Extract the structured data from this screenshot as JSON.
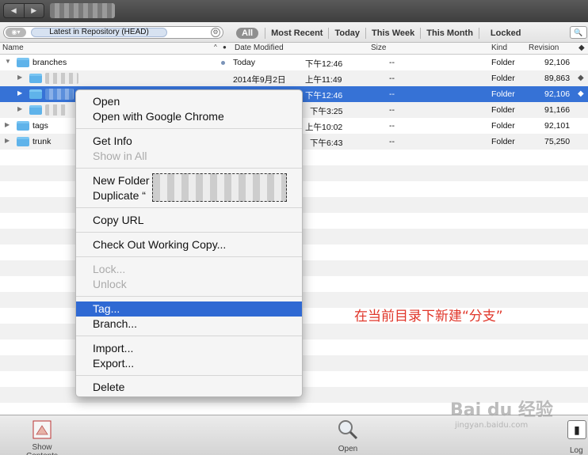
{
  "revision_field": {
    "toggle_icon": "toggle-icon",
    "value": "Latest in Repository (HEAD)",
    "gear_icon": "gear-icon"
  },
  "filters": [
    "All",
    "Most Recent",
    "Today",
    "This Week",
    "This Month",
    "Locked"
  ],
  "columns": {
    "name": "Name",
    "date_modified": "Date Modified",
    "size": "Size",
    "kind": "Kind",
    "revision": "Revision"
  },
  "rows": [
    {
      "name": "branches",
      "date": "Today",
      "time": "下午12:46",
      "size": "--",
      "kind": "Folder",
      "revision": "92,106"
    },
    {
      "name": "",
      "date": "2014年9月2日",
      "time": "上午11:49",
      "size": "--",
      "kind": "Folder",
      "revision": "89,863"
    },
    {
      "name": "",
      "date": "",
      "time": "下午12:46",
      "size": "--",
      "kind": "Folder",
      "revision": "92,106"
    },
    {
      "name": "",
      "date": "",
      "time": "下午3:25",
      "size": "--",
      "kind": "Folder",
      "revision": "91,166"
    },
    {
      "name": "tags",
      "date": "",
      "time": "上午10:02",
      "size": "--",
      "kind": "Folder",
      "revision": "92,101"
    },
    {
      "name": "trunk",
      "date": "",
      "time": "下午6:43",
      "size": "--",
      "kind": "Folder",
      "revision": "75,250"
    }
  ],
  "menu": {
    "open": "Open",
    "open_chrome": "Open with Google Chrome",
    "get_info": "Get Info",
    "show_in_all": "Show in All",
    "new_folder": "New Folder",
    "duplicate": "Duplicate “",
    "copy_url": "Copy URL",
    "checkout": "Check Out Working Copy...",
    "lock": "Lock...",
    "unlock": "Unlock",
    "tag": "Tag...",
    "branch": "Branch...",
    "import": "Import...",
    "export": "Export...",
    "delete": "Delete"
  },
  "annotation": "在当前目录下新建“分支”",
  "bottom": {
    "show_contents": "Show Contents",
    "open": "Open",
    "log": "Log"
  },
  "watermark": {
    "main": "Bai du 经验",
    "sub": "jingyan.baidu.com"
  },
  "colors": {
    "selection": "#3672d6",
    "menu_highlight": "#2f69d3",
    "annotation": "#e0362a",
    "folder": "#5fb3ea"
  }
}
